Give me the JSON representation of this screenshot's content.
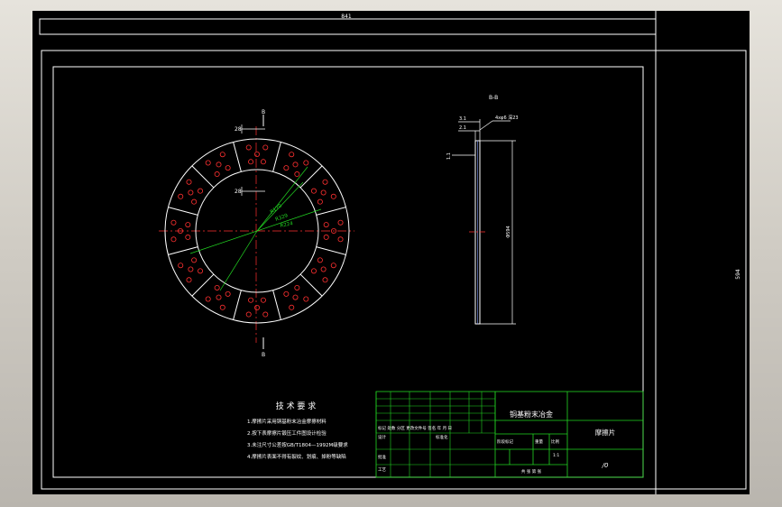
{
  "sheet": {
    "overall_width_dim": "841",
    "overall_height_dim": "594"
  },
  "front_view": {
    "section_mark_top": "B",
    "section_mark_bottom": "B",
    "dim_top_seg": "28",
    "dim_mid_seg": "28",
    "dim_radius_a": "R170",
    "dim_radius_b": "R329",
    "dim_radius_c": "R224"
  },
  "section_view": {
    "title": "B-B",
    "dim_a": "3.1",
    "dim_b": "2.1",
    "dim_c": "1.1",
    "note": "4xφ6 深23",
    "dim_height": "Φ594"
  },
  "tech_requirements": {
    "title": "技 术 要 求",
    "items": [
      "1.摩擦片采用铜基粉末冶金摩擦材料",
      "2.按下表摩擦片锻压工件图设计检验",
      "3.未注尺寸公差按GB/T1804—1992M级要求",
      "4.摩擦片表面不得有裂纹、划痕、掉粉等缺陷"
    ]
  },
  "title_block": {
    "material": "铜基粉末冶金",
    "part_name": "摩擦片",
    "drawing_no": "/0",
    "row_marks": "标记 处数 分区 更改文件号 签名 年 月 日",
    "label_designer": "设计",
    "label_standard": "标准化",
    "label_approve": "批准",
    "label_process": "工艺",
    "label_stage": "阶段标记",
    "label_weight": "重量",
    "label_scale": "比例",
    "scale_value": "1:1",
    "sheets": "共  张  第  张"
  }
}
